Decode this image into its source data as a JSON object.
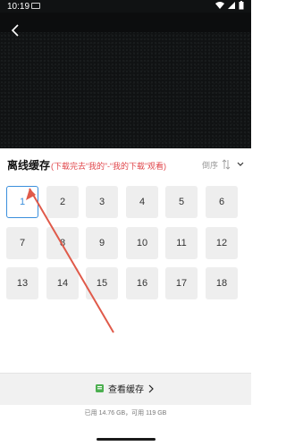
{
  "status_bar": {
    "time": "10:19"
  },
  "header": {
    "title": "离线缓存",
    "hint": "(下载完去“我的”-“我的下载”观看)",
    "sort_label": "倒序"
  },
  "episodes": [
    "1",
    "2",
    "3",
    "4",
    "5",
    "6",
    "7",
    "8",
    "9",
    "10",
    "11",
    "12",
    "13",
    "14",
    "15",
    "16",
    "17",
    "18"
  ],
  "selected_episode": "1",
  "footer": {
    "view_cache_label": "查看缓存",
    "storage_info": "已用 14.76 GB，可用 119 GB"
  },
  "colors": {
    "accent": "#3b8fdc",
    "hint": "#e0454a",
    "arrow": "#e05a4a"
  }
}
